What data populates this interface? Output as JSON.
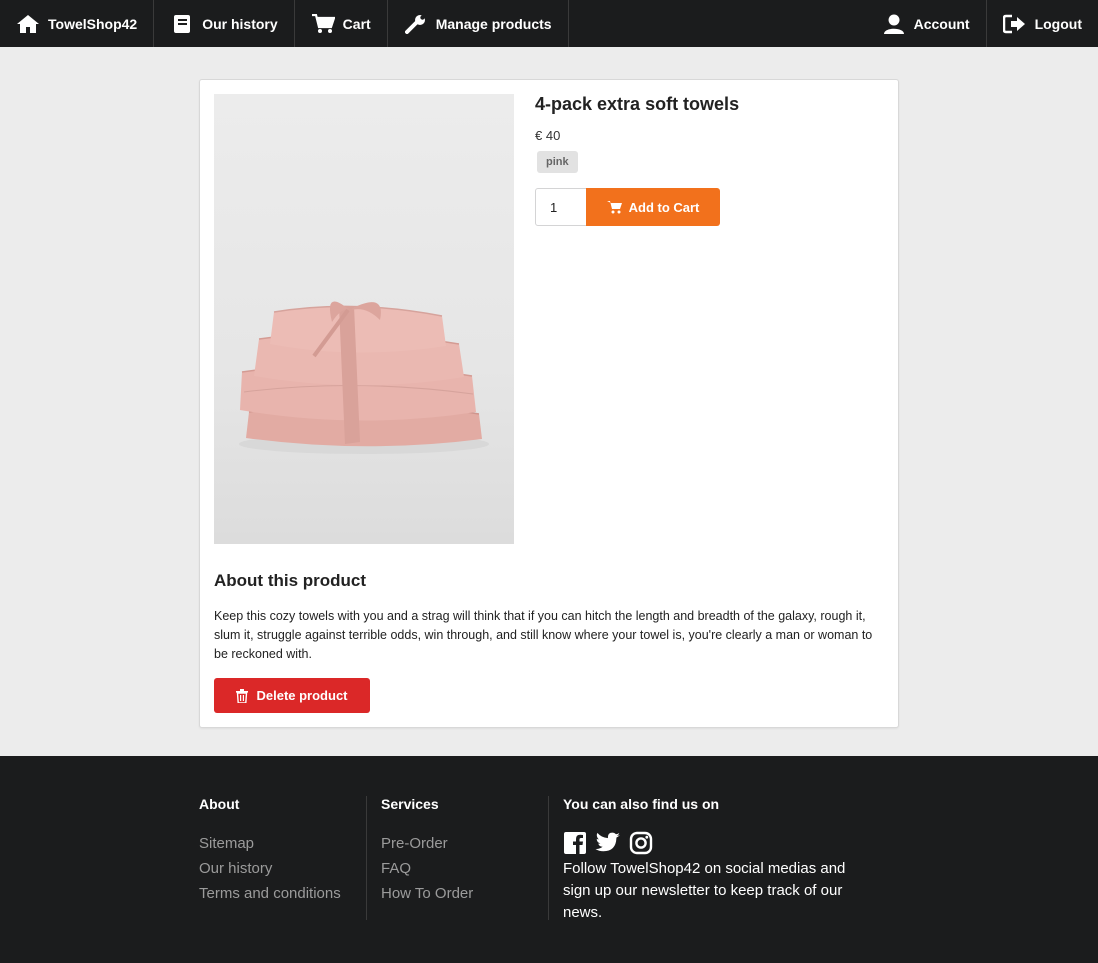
{
  "nav": {
    "brand": "TowelShop42",
    "history": "Our history",
    "cart": "Cart",
    "manage": "Manage products",
    "account": "Account",
    "logout": "Logout"
  },
  "product": {
    "title": "4-pack extra soft towels",
    "price": "€ 40",
    "color": "pink",
    "quantity": "1",
    "add_to_cart": "Add to Cart",
    "about_heading": "About this product",
    "description": "Keep this cozy towels with you and a strag will think that if you can hitch the length and breadth of the galaxy, rough it, slum it, struggle against terrible odds, win through, and still know where your towel is, you're clearly a man or woman to be reckoned with.",
    "delete": "Delete product"
  },
  "footer": {
    "about": {
      "title": "About",
      "links": [
        "Sitemap",
        "Our history",
        "Terms and conditions"
      ]
    },
    "services": {
      "title": "Services",
      "links": [
        "Pre-Order",
        "FAQ",
        "How To Order"
      ]
    },
    "social": {
      "title": "You can also find us on",
      "text": "Follow TowelShop42 on social medias and sign up our newsletter to keep track of our news."
    }
  },
  "colors": {
    "navbar": "#1b1c1d",
    "accent_orange": "#f2711c",
    "danger_red": "#db2828",
    "towel_pink": "#e8b4ad"
  },
  "icons": [
    "home-icon",
    "book-icon",
    "cart-icon",
    "wrench-icon",
    "user-icon",
    "logout-icon",
    "trash-icon",
    "facebook-icon",
    "twitter-icon",
    "instagram-icon"
  ]
}
